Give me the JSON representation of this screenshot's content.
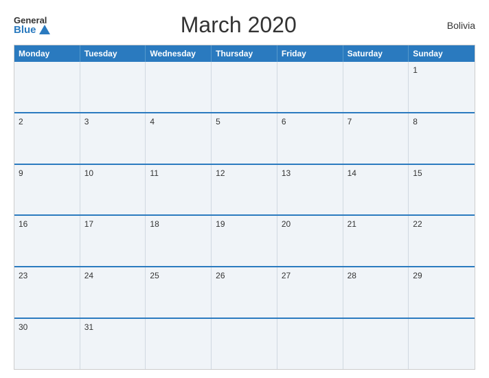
{
  "header": {
    "logo_general": "General",
    "logo_blue": "Blue",
    "title": "March 2020",
    "country": "Bolivia"
  },
  "days_of_week": [
    "Monday",
    "Tuesday",
    "Wednesday",
    "Thursday",
    "Friday",
    "Saturday",
    "Sunday"
  ],
  "weeks": [
    [
      null,
      null,
      null,
      null,
      null,
      null,
      1
    ],
    [
      2,
      3,
      4,
      5,
      6,
      7,
      8
    ],
    [
      9,
      10,
      11,
      12,
      13,
      14,
      15
    ],
    [
      16,
      17,
      18,
      19,
      20,
      21,
      22
    ],
    [
      23,
      24,
      25,
      26,
      27,
      28,
      29
    ],
    [
      30,
      31,
      null,
      null,
      null,
      null,
      null
    ]
  ]
}
